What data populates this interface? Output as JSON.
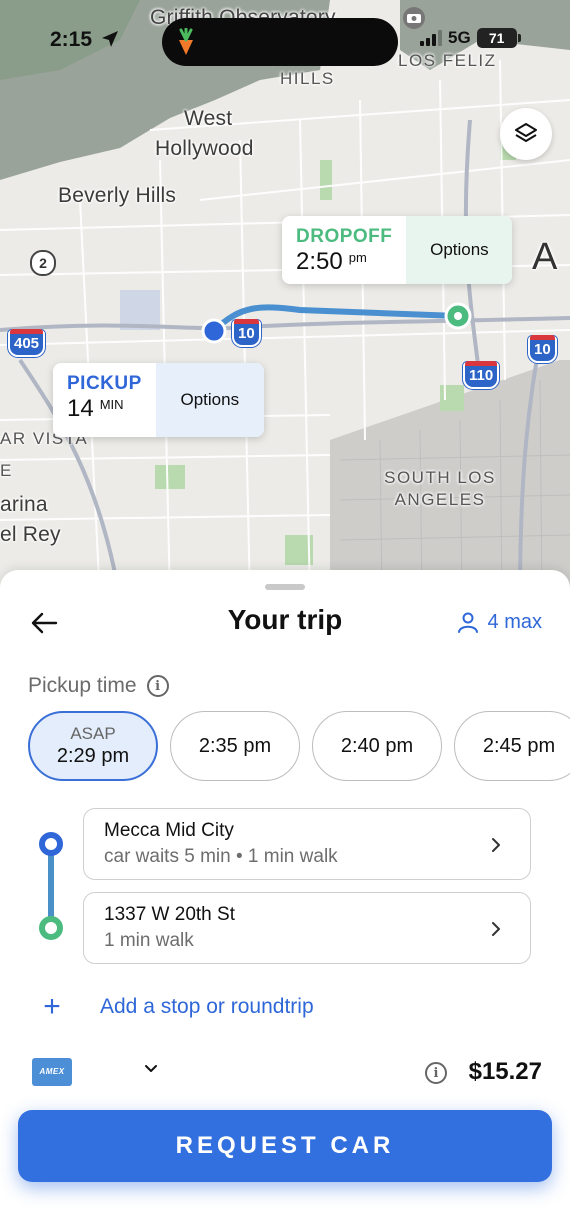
{
  "status_bar": {
    "time": "2:15",
    "network": "5G",
    "battery": "71"
  },
  "map": {
    "places": {
      "griffith": "Griffith Observatory",
      "hills": "HILLS",
      "los_feliz": "LOS FELIZ",
      "west_hollywood_1": "West",
      "west_hollywood_2": "Hollywood",
      "beverly_hills": "Beverly Hills",
      "mar_vista": "AR VISTA",
      "marina": "arina",
      "del_rey": "el Rey",
      "e_label": "E",
      "south_la_1": "SOUTH LOS",
      "south_la_2": "ANGELES",
      "la_a": "A"
    },
    "shields": {
      "i405": "405",
      "i10a": "10",
      "i10b": "10",
      "i110": "110",
      "state2": "2"
    },
    "dropoff": {
      "tag": "DROPOFF",
      "time": "2:50",
      "suffix": "pm",
      "options_label": "Options"
    },
    "pickup": {
      "tag": "PICKUP",
      "value": "14",
      "unit": "MIN",
      "options_label": "Options"
    },
    "layers_icon": "layers-icon"
  },
  "sheet": {
    "title": "Your trip",
    "max_riders": "4 max",
    "pickup_time_label": "Pickup time",
    "times": [
      {
        "top": "ASAP",
        "time": "2:29 pm",
        "selected": true
      },
      {
        "time": "2:35 pm"
      },
      {
        "time": "2:40 pm"
      },
      {
        "time": "2:45 pm"
      }
    ],
    "stops": [
      {
        "name": "Mecca Mid City",
        "detail": "car waits 5 min • 1 min walk"
      },
      {
        "name": "1337 W 20th St",
        "detail": "1 min walk"
      }
    ],
    "add_stop_label": "Add a stop or roundtrip",
    "payment": {
      "card_brand": "AMEX",
      "price": "$15.27"
    },
    "request_label": "REQUEST CAR"
  },
  "colors": {
    "accent_blue": "#3270e0",
    "dropoff_green": "#4cbb7f",
    "pickup_blue": "#2f67d8"
  }
}
